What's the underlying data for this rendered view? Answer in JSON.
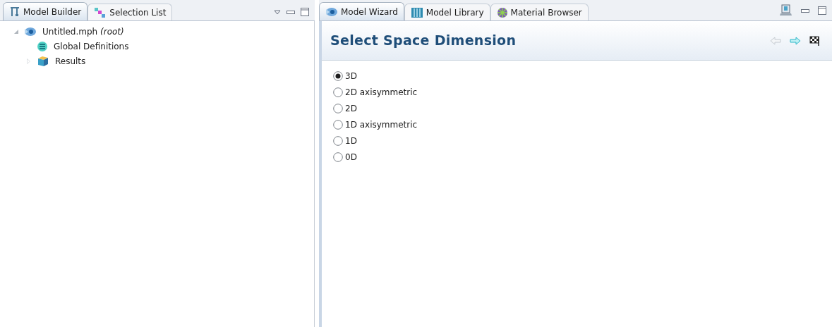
{
  "left_panel": {
    "tabs": [
      {
        "label": "Model Builder",
        "kind": "builder",
        "selected": true
      },
      {
        "label": "Selection List",
        "kind": "selection",
        "selected": false
      }
    ],
    "tree": [
      {
        "label": "Untitled.mph *(root)*",
        "kind": "model",
        "expanded": true,
        "children": [
          {
            "label": "Global Definitions",
            "kind": "definitions"
          },
          {
            "label": "Results",
            "kind": "results",
            "expanded": false
          }
        ]
      }
    ]
  },
  "right_panel": {
    "tabs": [
      {
        "label": "Model Wizard",
        "kind": "model",
        "selected": true
      },
      {
        "label": "Model Library",
        "kind": "library",
        "selected": false
      },
      {
        "label": "Material Browser",
        "kind": "material",
        "selected": false
      }
    ],
    "wizard": {
      "title": "Select Space Dimension",
      "nav": [
        {
          "kind": "back",
          "disabled": true
        },
        {
          "kind": "forward",
          "disabled": false
        },
        {
          "kind": "finish",
          "disabled": false
        }
      ],
      "options": [
        {
          "label": "3D",
          "selected": true
        },
        {
          "label": "2D axisymmetric",
          "selected": false
        },
        {
          "label": "2D",
          "selected": false
        },
        {
          "label": "1D axisymmetric",
          "selected": false
        },
        {
          "label": "1D",
          "selected": false
        },
        {
          "label": "0D",
          "selected": false
        }
      ]
    }
  }
}
